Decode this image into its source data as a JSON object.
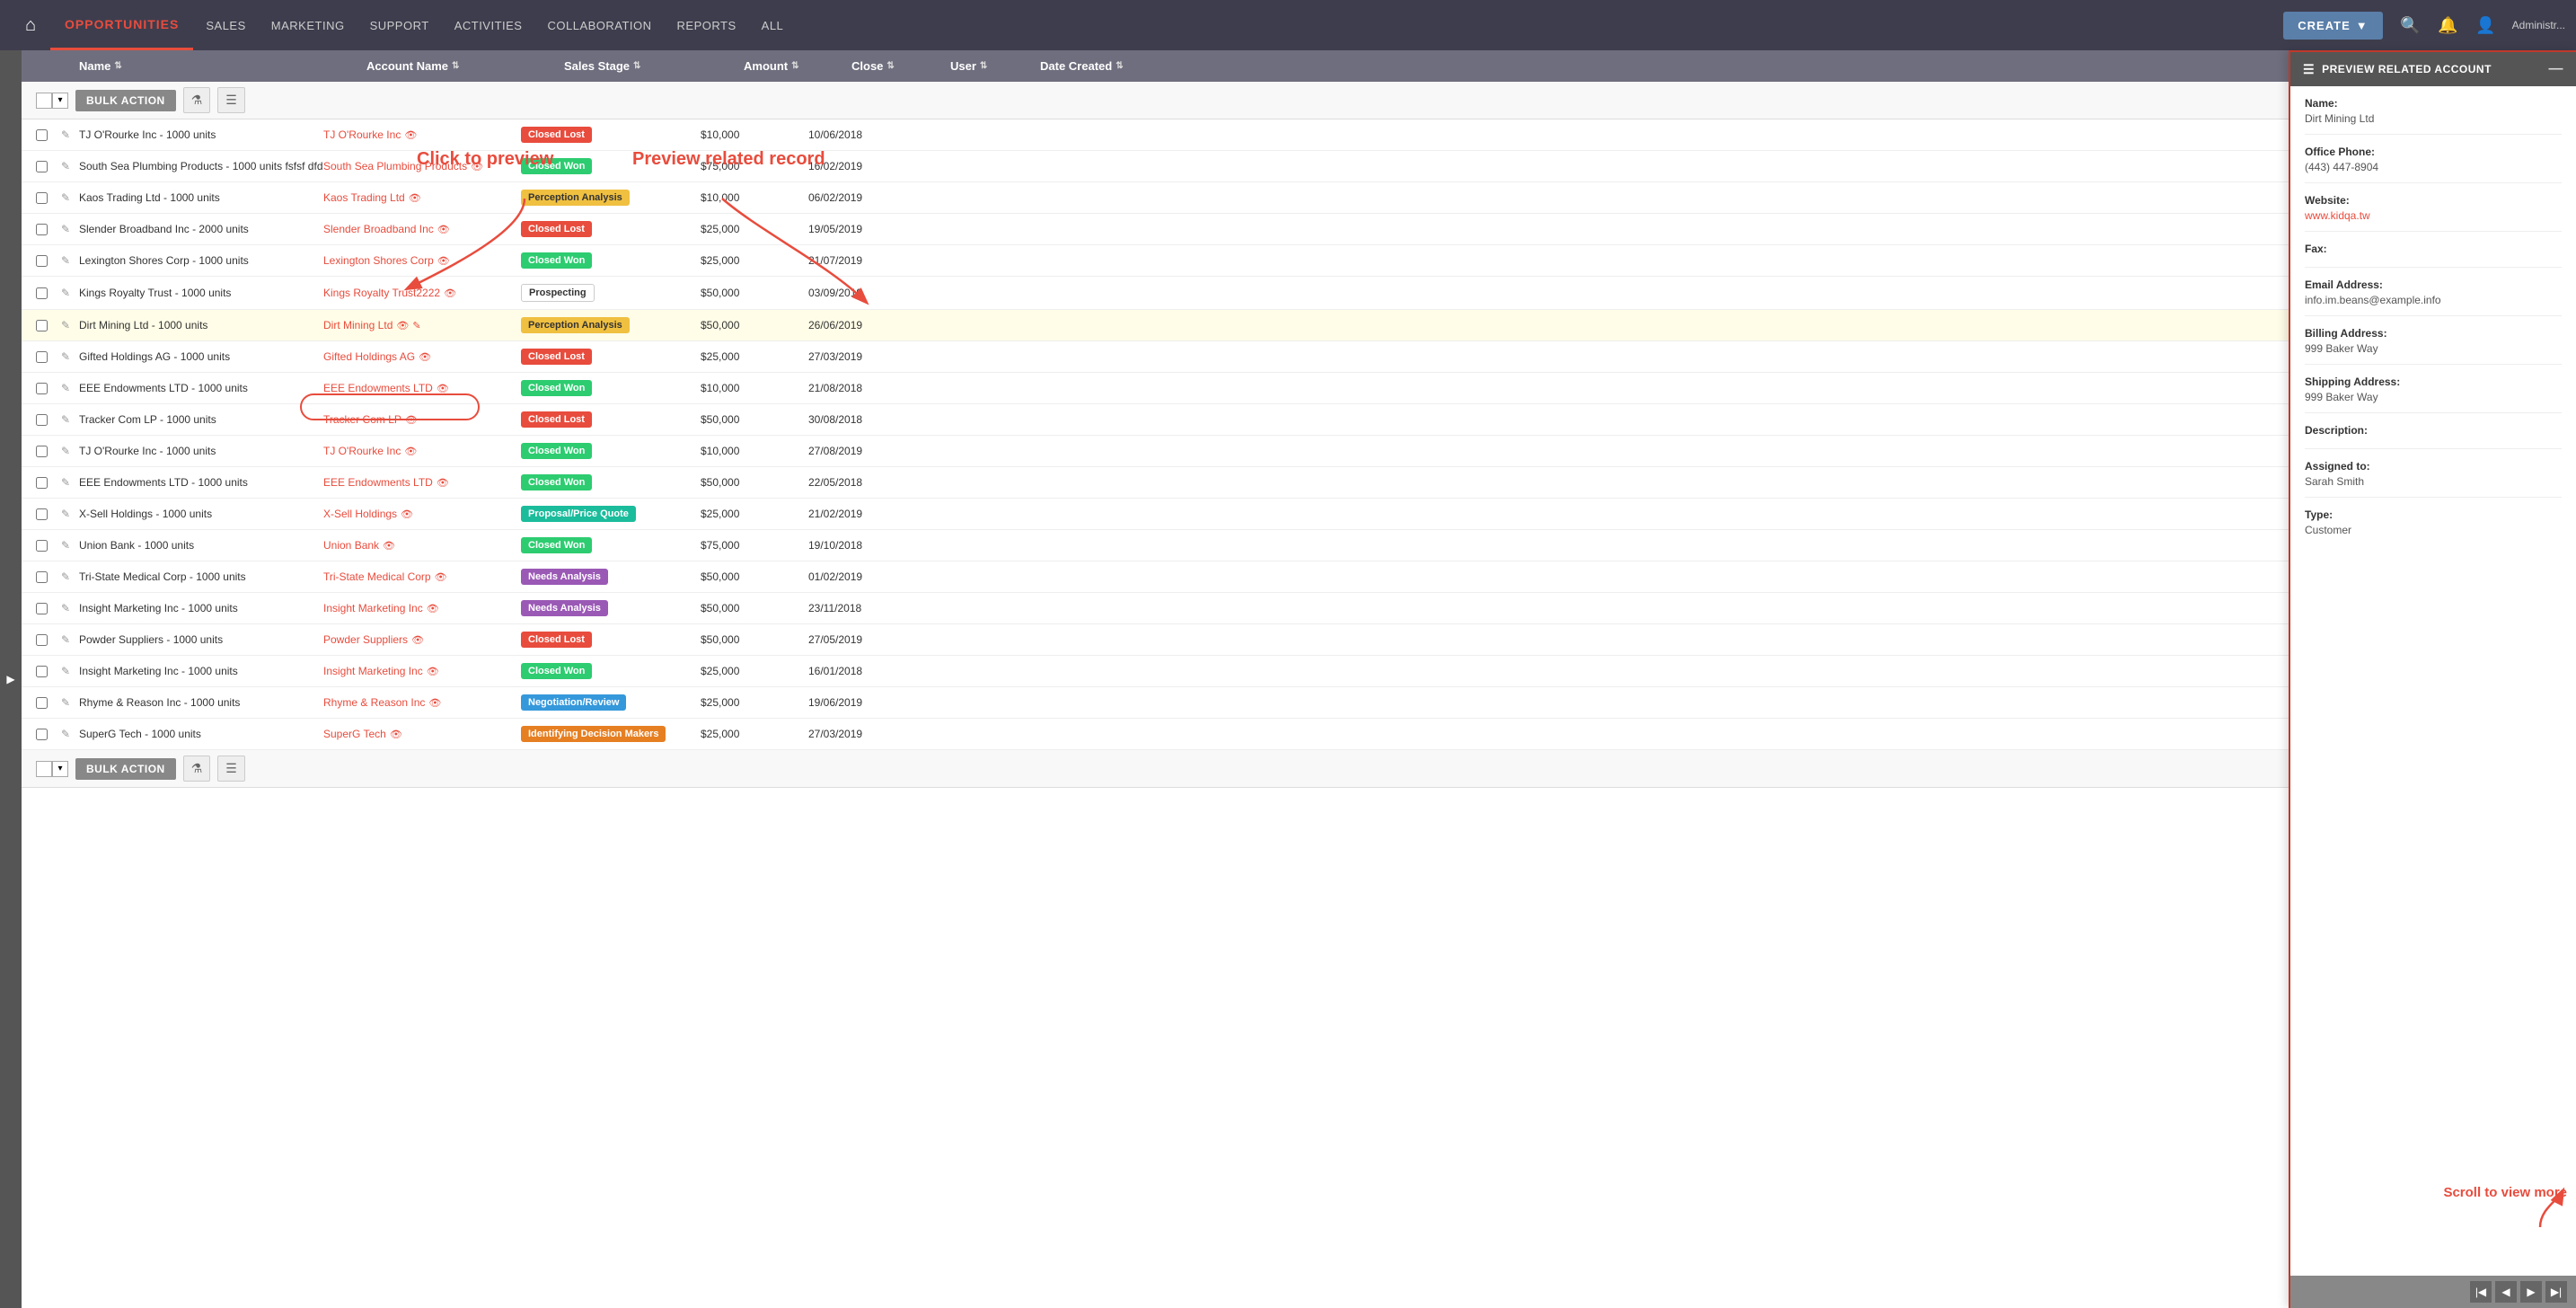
{
  "topnav": {
    "brand": "OPPORTUNITIES",
    "items": [
      "SALES",
      "MARKETING",
      "SUPPORT",
      "ACTIVITIES",
      "COLLABORATION",
      "REPORTS",
      "ALL"
    ],
    "create_label": "CREATE",
    "user_label": "Administr..."
  },
  "toolbar": {
    "bulk_action": "BULK ACTION",
    "bulk_action_bottom": "BULK ACTION"
  },
  "table": {
    "headers": {
      "name": "Name",
      "account": "Account Name",
      "stage": "Sales Stage",
      "amount": "Amount",
      "close": "Close",
      "user": "User",
      "date": "Date Created"
    },
    "rows": [
      {
        "name": "TJ O'Rourke Inc - 1000 units",
        "account": "TJ O'Rourke Inc",
        "stage": "Closed Lost",
        "stage_class": "stage-closed-lost",
        "amount": "$10,000",
        "close": "10/06/2018",
        "user": ""
      },
      {
        "name": "South Sea Plumbing Products - 1000 units fsfsf dfd",
        "account": "South Sea Plumbing Products",
        "stage": "Closed Won",
        "stage_class": "stage-closed-won",
        "amount": "$75,000",
        "close": "16/02/2019",
        "user": ""
      },
      {
        "name": "Kaos Trading Ltd - 1000 units",
        "account": "Kaos Trading Ltd",
        "stage": "Perception Analysis",
        "stage_class": "stage-perception",
        "amount": "$10,000",
        "close": "06/02/2019",
        "user": ""
      },
      {
        "name": "Slender Broadband Inc - 2000 units",
        "account": "Slender Broadband Inc",
        "stage": "Closed Lost",
        "stage_class": "stage-closed-lost",
        "amount": "$25,000",
        "close": "19/05/2019",
        "user": ""
      },
      {
        "name": "Lexington Shores Corp - 1000 units",
        "account": "Lexington Shores Corp",
        "stage": "Closed Won",
        "stage_class": "stage-closed-won",
        "amount": "$25,000",
        "close": "21/07/2019",
        "user": ""
      },
      {
        "name": "Kings Royalty Trust - 1000 units",
        "account": "Kings Royalty Trust2222",
        "stage": "Prospecting",
        "stage_class": "stage-prospecting",
        "amount": "$50,000",
        "close": "03/09/2019",
        "user": ""
      },
      {
        "name": "Dirt Mining Ltd - 1000 units",
        "account": "Dirt Mining Ltd",
        "stage": "Perception Analysis",
        "stage_class": "stage-perception",
        "amount": "$50,000",
        "close": "26/06/2019",
        "user": "",
        "highlighted": true
      },
      {
        "name": "Gifted Holdings AG - 1000 units",
        "account": "Gifted Holdings AG",
        "stage": "Closed Lost",
        "stage_class": "stage-closed-lost",
        "amount": "$25,000",
        "close": "27/03/2019",
        "user": ""
      },
      {
        "name": "EEE Endowments LTD - 1000 units",
        "account": "EEE Endowments LTD",
        "stage": "Closed Won",
        "stage_class": "stage-closed-won",
        "amount": "$10,000",
        "close": "21/08/2018",
        "user": ""
      },
      {
        "name": "Tracker Com LP - 1000 units",
        "account": "Tracker Com LP",
        "stage": "Closed Lost",
        "stage_class": "stage-closed-lost",
        "amount": "$50,000",
        "close": "30/08/2018",
        "user": ""
      },
      {
        "name": "TJ O'Rourke Inc - 1000 units",
        "account": "TJ O'Rourke Inc",
        "stage": "Closed Won",
        "stage_class": "stage-closed-won",
        "amount": "$10,000",
        "close": "27/08/2019",
        "user": ""
      },
      {
        "name": "EEE Endowments LTD - 1000 units",
        "account": "EEE Endowments LTD",
        "stage": "Closed Won",
        "stage_class": "stage-closed-won",
        "amount": "$50,000",
        "close": "22/05/2018",
        "user": ""
      },
      {
        "name": "X-Sell Holdings - 1000 units",
        "account": "X-Sell Holdings",
        "stage": "Proposal/Price Quote",
        "stage_class": "stage-proposal",
        "amount": "$25,000",
        "close": "21/02/2019",
        "user": ""
      },
      {
        "name": "Union Bank - 1000 units",
        "account": "Union Bank",
        "stage": "Closed Won",
        "stage_class": "stage-closed-won",
        "amount": "$75,000",
        "close": "19/10/2018",
        "user": ""
      },
      {
        "name": "Tri-State Medical Corp - 1000 units",
        "account": "Tri-State Medical Corp",
        "stage": "Needs Analysis",
        "stage_class": "stage-needs",
        "amount": "$50,000",
        "close": "01/02/2019",
        "user": ""
      },
      {
        "name": "Insight Marketing Inc - 1000 units",
        "account": "Insight Marketing Inc",
        "stage": "Needs Analysis",
        "stage_class": "stage-needs",
        "amount": "$50,000",
        "close": "23/11/2018",
        "user": ""
      },
      {
        "name": "Powder Suppliers - 1000 units",
        "account": "Powder Suppliers",
        "stage": "Closed Lost",
        "stage_class": "stage-closed-lost",
        "amount": "$50,000",
        "close": "27/05/2019",
        "user": ""
      },
      {
        "name": "Insight Marketing Inc - 1000 units",
        "account": "Insight Marketing Inc",
        "stage": "Closed Won",
        "stage_class": "stage-closed-won",
        "amount": "$25,000",
        "close": "16/01/2018",
        "user": ""
      },
      {
        "name": "Rhyme & Reason Inc - 1000 units",
        "account": "Rhyme & Reason Inc",
        "stage": "Negotiation/Review",
        "stage_class": "stage-negotiation",
        "amount": "$25,000",
        "close": "19/06/2019",
        "user": ""
      },
      {
        "name": "SuperG Tech - 1000 units",
        "account": "SuperG Tech",
        "stage": "Identifying Decision Makers",
        "stage_class": "stage-identifying",
        "amount": "$25,000",
        "close": "27/03/2019",
        "user": ""
      }
    ]
  },
  "preview_panel": {
    "title": "PREVIEW RELATED ACCOUNT",
    "fields": [
      {
        "label": "Name:",
        "value": "Dirt Mining Ltd",
        "type": "text"
      },
      {
        "label": "Office Phone:",
        "value": "(443) 447-8904",
        "type": "text"
      },
      {
        "label": "Website:",
        "value": "www.kidqa.tw",
        "type": "link"
      },
      {
        "label": "Fax:",
        "value": "",
        "type": "text"
      },
      {
        "label": "Email Address:",
        "value": "info.im.beans@example.info",
        "type": "text"
      },
      {
        "label": "Billing Address:",
        "value": "999 Baker Way",
        "type": "text"
      },
      {
        "label": "Shipping Address:",
        "value": "999 Baker Way",
        "type": "text"
      },
      {
        "label": "Description:",
        "value": "",
        "type": "text"
      },
      {
        "label": "Assigned to:",
        "value": "Sarah Smith",
        "type": "text"
      },
      {
        "label": "Type:",
        "value": "Customer",
        "type": "text"
      }
    ]
  },
  "annotations": {
    "click_to_preview": "Click to preview",
    "preview_related": "Preview related record",
    "scroll_to_view": "Scroll to view more"
  }
}
